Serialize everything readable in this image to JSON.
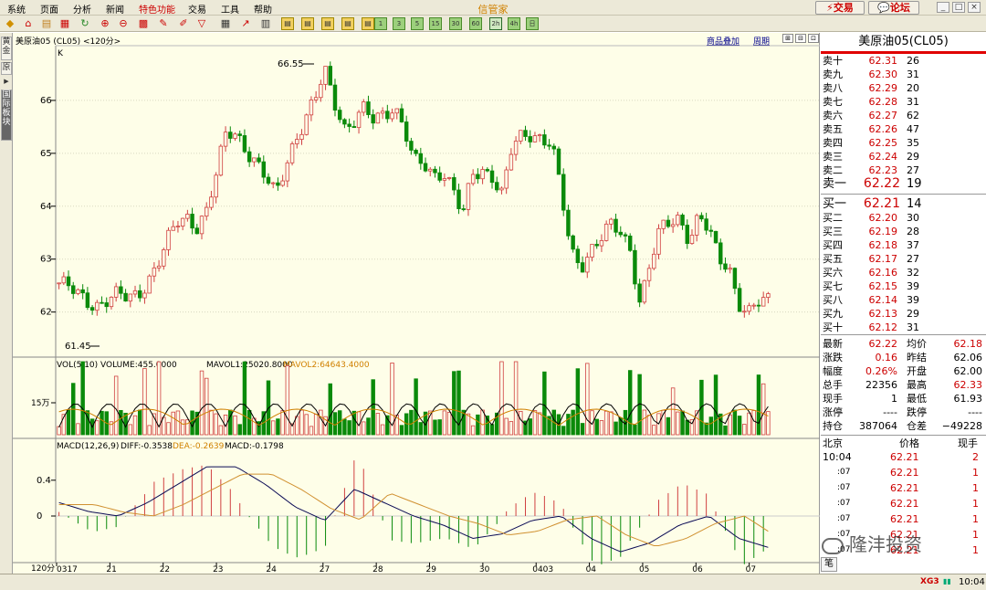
{
  "app": {
    "title": "信管家",
    "trade_button": "交易",
    "forum_button": "论坛"
  },
  "menu": [
    "系统",
    "页面",
    "分析",
    "新闻",
    "特色功能",
    "交易",
    "工具",
    "帮助"
  ],
  "toolbar": {
    "period_buttons": [
      "1",
      "3",
      "5",
      "15",
      "30",
      "60",
      "2h",
      "4h",
      "日"
    ]
  },
  "left_tabs": [
    "黄金",
    "原",
    "国际板块"
  ],
  "chart": {
    "header": "美原油05 (CL05) <120分>",
    "link_overlay": "商品叠加",
    "link_period": "周期",
    "k_marker": "K",
    "vol_title": "VOL(5,10) VOLUME:455.0000",
    "mavol1": "MAVOL1:25020.8000",
    "mavol2": "MAVOL2:64643.4000",
    "vol_axis_label": "15万",
    "macd_title": "MACD(12,26,9)",
    "diff": "DIFF:-0.3538",
    "dea": "DEA:-0.2639",
    "macd_val": "MACD:-0.1798",
    "bottom_left_label": "120分",
    "high_label": "66.55",
    "low_label": "61.45"
  },
  "chart_data": {
    "type": "candlestick",
    "period": "120分",
    "price_axis": {
      "ticks": [
        62,
        63,
        64,
        65,
        66
      ],
      "range": [
        61.2,
        67.0
      ]
    },
    "x_tick_labels": [
      "0317",
      "21",
      "22",
      "23",
      "24",
      "27",
      "28",
      "29",
      "30",
      "0403",
      "04",
      "05",
      "06",
      "07"
    ],
    "price_path": [
      62.55,
      62.45,
      62.3,
      62.2,
      62.15,
      62.25,
      62.3,
      62.25,
      62.35,
      62.6,
      62.9,
      63.3,
      63.7,
      63.8,
      63.65,
      63.9,
      64.6,
      65.4,
      65.4,
      65.1,
      64.8,
      64.5,
      64.2,
      64.8,
      65.3,
      65.6,
      66.0,
      66.55,
      66.0,
      65.5,
      65.6,
      65.8,
      65.6,
      65.8,
      65.9,
      65.5,
      64.8,
      64.8,
      64.6,
      64.7,
      64.3,
      63.8,
      64.6,
      64.7,
      64.6,
      64.2,
      65.1,
      65.3,
      65.4,
      65.3,
      65.2,
      64.2,
      63.1,
      62.9,
      63.2,
      63.4,
      63.6,
      63.5,
      63.2,
      62.2,
      62.9,
      63.5,
      63.7,
      63.8,
      63.4,
      63.8,
      63.5,
      63.0,
      62.9,
      62.2,
      61.95,
      62.15,
      62.22
    ],
    "high": 66.55,
    "low": 61.45,
    "volume_axis": {
      "ticks": [
        "15万"
      ],
      "tick_value": 150000
    },
    "macd_axis": {
      "ticks": [
        0.4,
        0
      ]
    },
    "macd_last": {
      "diff": -0.3538,
      "dea": -0.2639,
      "macd": -0.1798
    }
  },
  "quote": {
    "title": "美原油05(CL05)",
    "asks": [
      {
        "label": "卖十",
        "price": "62.31",
        "vol": "26"
      },
      {
        "label": "卖九",
        "price": "62.30",
        "vol": "31"
      },
      {
        "label": "卖八",
        "price": "62.29",
        "vol": "20"
      },
      {
        "label": "卖七",
        "price": "62.28",
        "vol": "31"
      },
      {
        "label": "卖六",
        "price": "62.27",
        "vol": "62"
      },
      {
        "label": "卖五",
        "price": "62.26",
        "vol": "47"
      },
      {
        "label": "卖四",
        "price": "62.25",
        "vol": "35"
      },
      {
        "label": "卖三",
        "price": "62.24",
        "vol": "29"
      },
      {
        "label": "卖二",
        "price": "62.23",
        "vol": "27"
      },
      {
        "label": "卖一",
        "price": "62.22",
        "vol": "19"
      }
    ],
    "bids": [
      {
        "label": "买一",
        "price": "62.21",
        "vol": "14"
      },
      {
        "label": "买二",
        "price": "62.20",
        "vol": "30"
      },
      {
        "label": "买三",
        "price": "62.19",
        "vol": "28"
      },
      {
        "label": "买四",
        "price": "62.18",
        "vol": "37"
      },
      {
        "label": "买五",
        "price": "62.17",
        "vol": "27"
      },
      {
        "label": "买六",
        "price": "62.16",
        "vol": "32"
      },
      {
        "label": "买七",
        "price": "62.15",
        "vol": "39"
      },
      {
        "label": "买八",
        "price": "62.14",
        "vol": "39"
      },
      {
        "label": "买九",
        "price": "62.13",
        "vol": "29"
      },
      {
        "label": "买十",
        "price": "62.12",
        "vol": "31"
      }
    ],
    "stats": [
      [
        "最新",
        "62.22",
        "均价",
        "62.18"
      ],
      [
        "涨跌",
        "0.16",
        "昨结",
        "62.06"
      ],
      [
        "幅度",
        "0.26%",
        "开盘",
        "62.00"
      ],
      [
        "总手",
        "22356",
        "最高",
        "62.33"
      ],
      [
        "现手",
        "1",
        "最低",
        "61.93"
      ],
      [
        "涨停",
        "----",
        "跌停",
        "----"
      ],
      [
        "持仓",
        "387064",
        "仓差",
        "−49228"
      ]
    ],
    "ticks_header": [
      "北京",
      "价格",
      "现手"
    ],
    "ticks": [
      {
        "time": "10:04",
        "price": "62.21",
        "vol": "2"
      },
      {
        "time": ":07",
        "price": "62.21",
        "vol": "1"
      },
      {
        "time": ":07",
        "price": "62.21",
        "vol": "1"
      },
      {
        "time": ":07",
        "price": "62.21",
        "vol": "1"
      },
      {
        "time": ":07",
        "price": "62.21",
        "vol": "1"
      },
      {
        "time": ":07",
        "price": "62.21",
        "vol": "1"
      },
      {
        "time": ":07",
        "price": "62.21",
        "vol": "1"
      }
    ],
    "corner": "笔"
  },
  "watermark": "隆沣投资",
  "status": {
    "time": "10:04",
    "brand": "XG3"
  }
}
